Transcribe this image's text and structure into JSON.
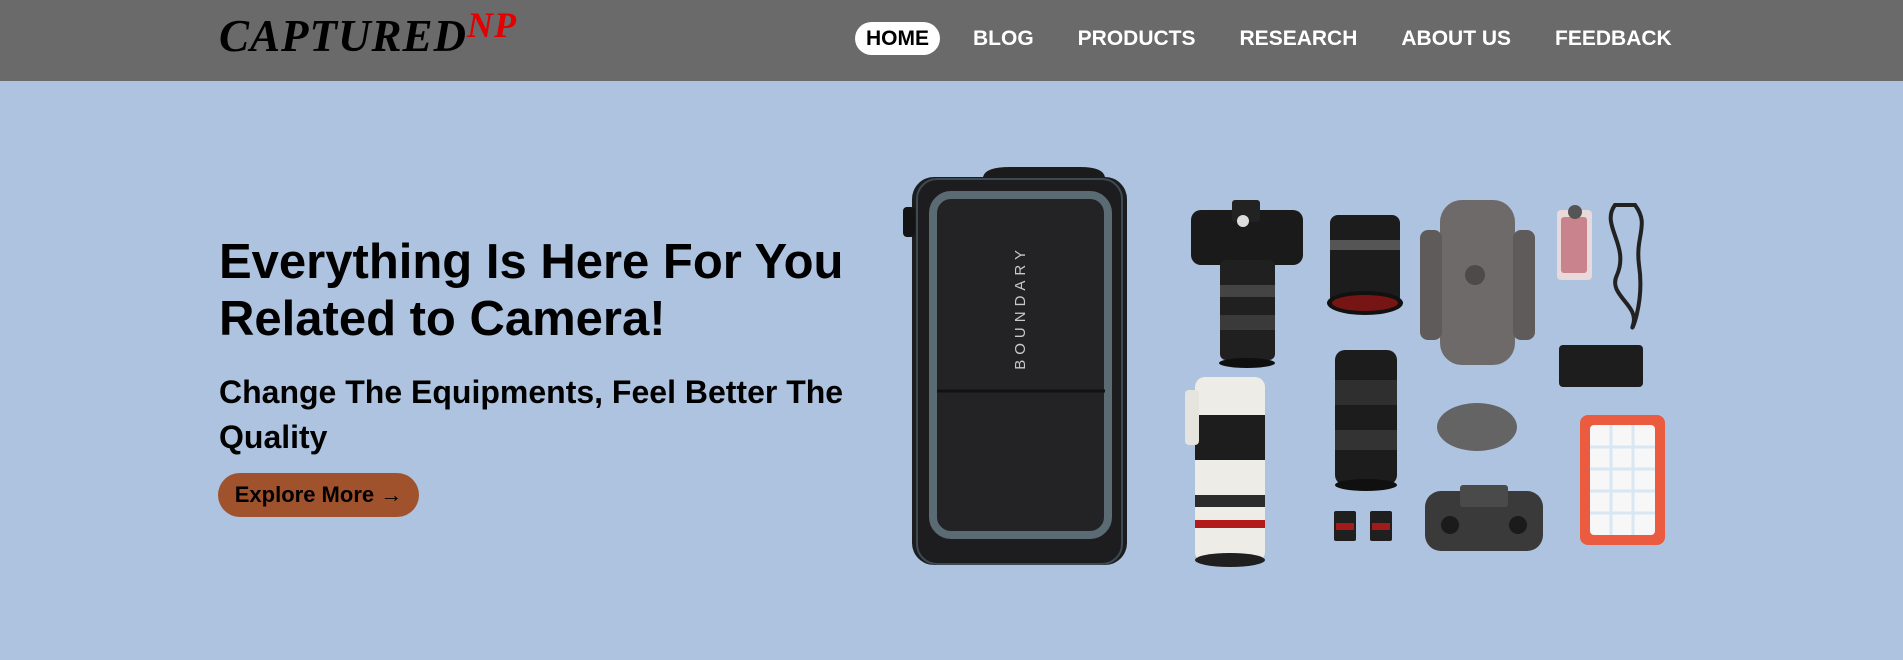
{
  "header": {
    "logo_text": "CAPTURED",
    "logo_sup": "NP",
    "nav": [
      {
        "label": "HOME",
        "active": true
      },
      {
        "label": "BLOG",
        "active": false
      },
      {
        "label": "PRODUCTS",
        "active": false
      },
      {
        "label": "RESEARCH",
        "active": false
      },
      {
        "label": "ABOUT US",
        "active": false
      },
      {
        "label": "FEEDBACK",
        "active": false
      }
    ]
  },
  "hero": {
    "title": "Everything Is Here For You Related to Camera!",
    "subtitle": "Change The Equipments, Feel Better The Quality",
    "cta_label": "Explore More →",
    "backpack_brand": "BOUNDARY"
  },
  "colors": {
    "header_bg": "#6a6a6a",
    "page_bg": "#aec3df",
    "logo_sup": "#e30000",
    "cta_bg": "#a0522d"
  }
}
